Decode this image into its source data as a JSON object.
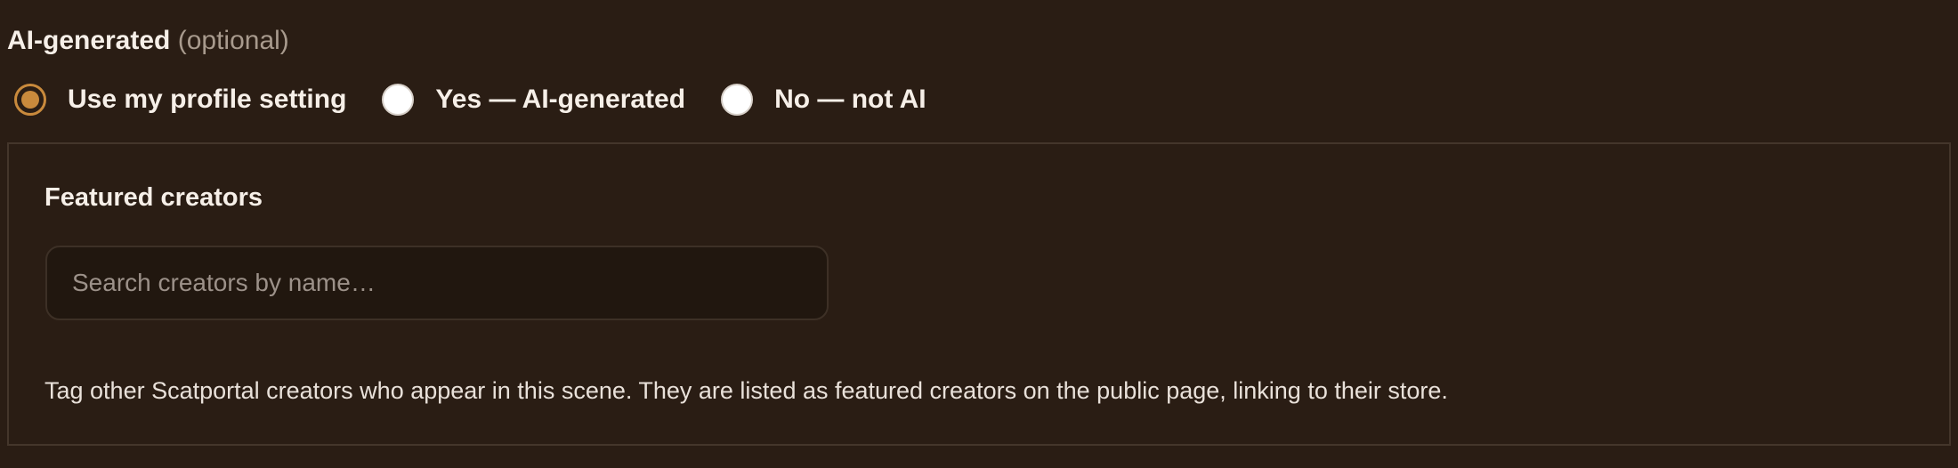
{
  "ai_generated": {
    "label": "AI-generated",
    "optional_text": "(optional)",
    "options": [
      {
        "label": "Use my profile setting",
        "checked": true
      },
      {
        "label": "Yes — AI-generated",
        "checked": false
      },
      {
        "label": "No — not AI",
        "checked": false
      }
    ]
  },
  "featured_creators": {
    "title": "Featured creators",
    "search_placeholder": "Search creators by name…",
    "search_value": "",
    "help_text": "Tag other Scatportal creators who appear in this scene. They are listed as featured creators on the public page, linking to their store."
  },
  "colors": {
    "background": "#2a1d14",
    "accent": "#c98a3c",
    "panel_border": "#44362b",
    "input_background": "#21170f"
  }
}
